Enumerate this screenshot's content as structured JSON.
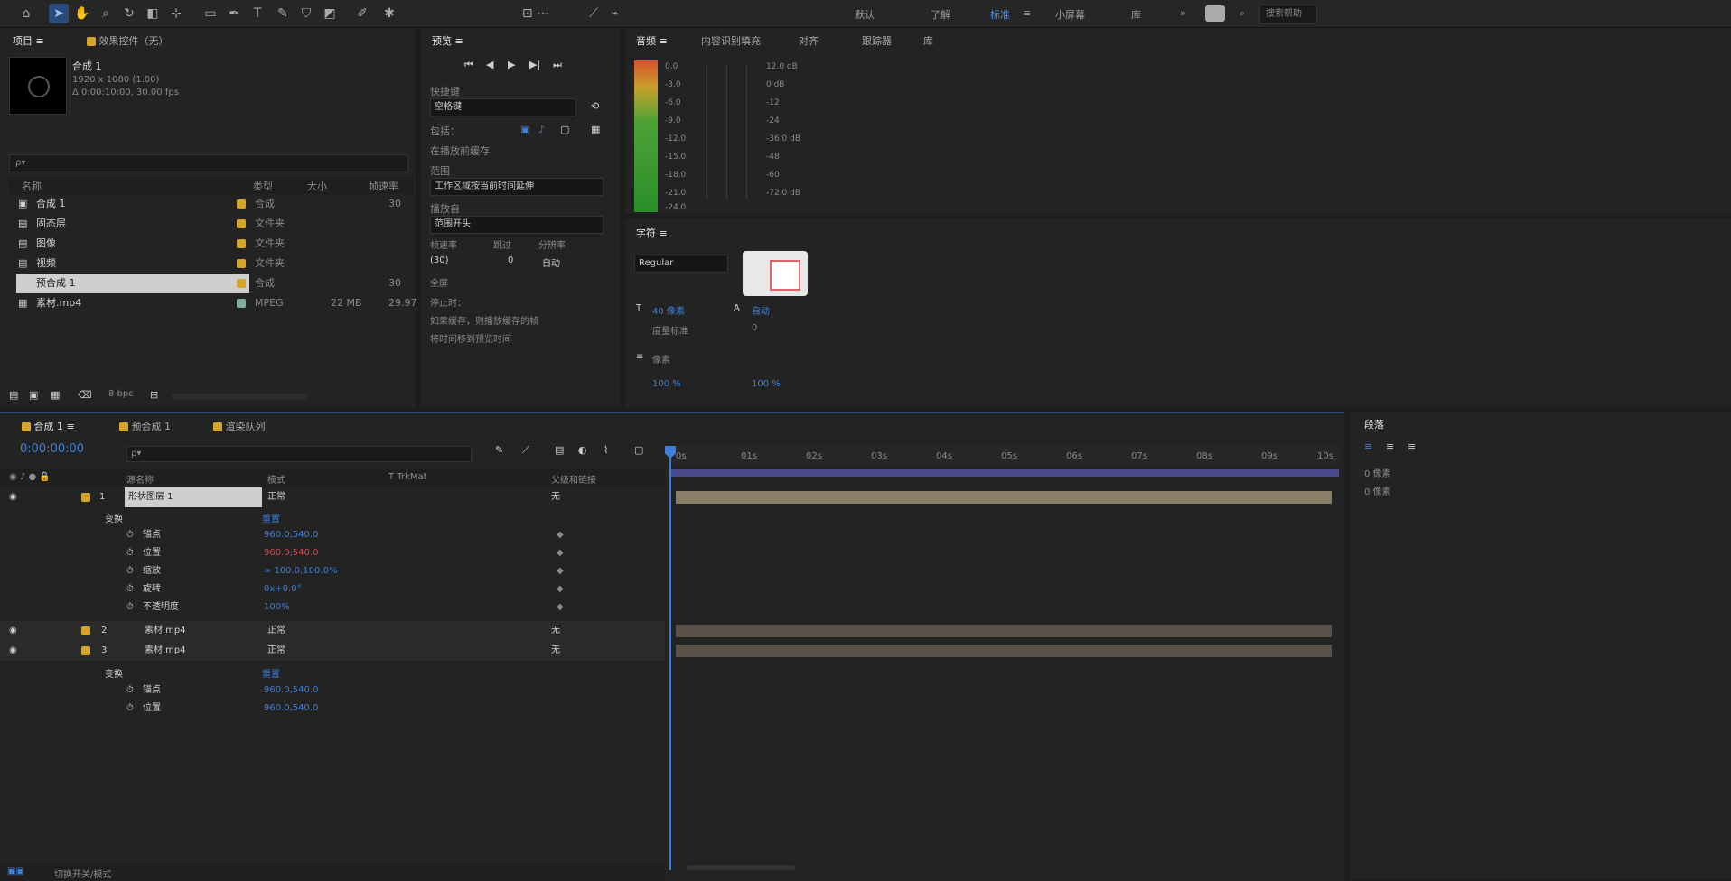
{
  "toolbar": {
    "workspaces": [
      "默认",
      "了解",
      "标准",
      "小屏幕",
      "库"
    ],
    "active_workspace": "标准",
    "search_placeholder": "搜索帮助"
  },
  "project_panel": {
    "tab_label": "项目 ≡",
    "comp_tab": "效果控件（无）",
    "preview_title": "合成 1",
    "preview_line1": "1920 x 1080 (1.00)",
    "preview_line2": "Δ 0:00:10:00, 30.00 fps",
    "search_placeholder": "ρ▾",
    "columns": {
      "name": "名称",
      "type": "类型",
      "size": "大小",
      "duration": "帧速率"
    },
    "items": [
      {
        "name": "合成 1",
        "type": "合成",
        "size": "",
        "duration": "30"
      },
      {
        "name": "固态层",
        "type": "文件夹",
        "size": "",
        "duration": ""
      },
      {
        "name": "图像",
        "type": "文件夹",
        "size": "",
        "duration": ""
      },
      {
        "name": "视频",
        "type": "文件夹",
        "size": "",
        "duration": ""
      },
      {
        "name": "预合成 1",
        "type": "合成",
        "size": "",
        "duration": "30"
      },
      {
        "name": "素材.mp4",
        "type": "MPEG",
        "size": "22 MB",
        "duration": "29.97"
      }
    ],
    "footer_bpc": "8 bpc"
  },
  "effects_panel": {
    "tab_label": "预览 ≡",
    "section_shortcut": "快捷键",
    "shortcut_value": "空格键",
    "include_label": "包括：",
    "cache_label": "在播放前缓存",
    "range_label": "范围",
    "range_value": "工作区域按当前时间延伸",
    "play_from_label": "播放自",
    "play_from_value": "范围开头",
    "frame_rate_label": "帧速率",
    "skip_label": "跳过",
    "resolution_label": "分辨率",
    "frame_rate_value": "(30)",
    "skip_value": "0",
    "resolution_value": "自动",
    "fullscreen_label": "全屏",
    "stop_label": "停止时：",
    "stop_option": "如果缓存，则播放缓存的帧",
    "move_time_label": "将时间移到预览时间"
  },
  "audio_panel": {
    "tabs": [
      "音频 ≡",
      "内容识别填充",
      "对齐",
      "跟踪器",
      "库"
    ],
    "db_labels": [
      "0.0",
      "-3.0",
      "-6.0",
      "-9.0",
      "-12.0",
      "-15.0",
      "-18.0",
      "-21.0",
      "-24.0"
    ],
    "right_labels": [
      "12.0 dB",
      "0 dB",
      "-12",
      "-24",
      "-36.0 dB",
      "-48",
      "-60",
      "-72.0 dB"
    ]
  },
  "character_panel": {
    "tab_label": "字符 ≡",
    "font_label": "Regular",
    "size_label": "像素",
    "rows": [
      "40 像素",
      "自动",
      "度量标准",
      "0",
      "100 %",
      "100 %"
    ]
  },
  "timeline": {
    "tabs": [
      "合成 1 ≡",
      "预合成 1",
      "渲染队列"
    ],
    "timecode": "0:00:00:00",
    "search_placeholder": "ρ▾",
    "columns": {
      "source": "源名称",
      "mode": "模式",
      "trkmat": "T TrkMat",
      "parent": "父级和链接"
    },
    "layers": [
      {
        "num": "1",
        "name": "形状图层 1",
        "mode": "正常",
        "parent": "无"
      },
      {
        "num": "2",
        "name": "素材.mp4",
        "mode": "正常",
        "parent": "无"
      },
      {
        "num": "3",
        "name": "素材.mp4",
        "mode": "正常",
        "parent": "无"
      }
    ],
    "props": [
      {
        "name": "锚点",
        "value": "960.0,540.0",
        "color": "blue"
      },
      {
        "name": "位置",
        "value": "960.0,540.0",
        "color": "red"
      },
      {
        "name": "缩放",
        "value": "∞ 100.0,100.0%",
        "color": "blue"
      },
      {
        "name": "旋转",
        "value": "0x+0.0°",
        "color": "blue"
      },
      {
        "name": "不透明度",
        "value": "100%",
        "color": "blue"
      }
    ],
    "group_label": "变换",
    "reset_label": "重置",
    "toggle_label": "切换开关/模式",
    "ruler_labels": [
      "0s",
      "01s",
      "02s",
      "03s",
      "04s",
      "05s",
      "06s",
      "07s",
      "08s",
      "09s",
      "10s"
    ]
  },
  "side_panel": {
    "title": "段落",
    "labels": [
      "0 像素",
      "0 像素"
    ]
  }
}
